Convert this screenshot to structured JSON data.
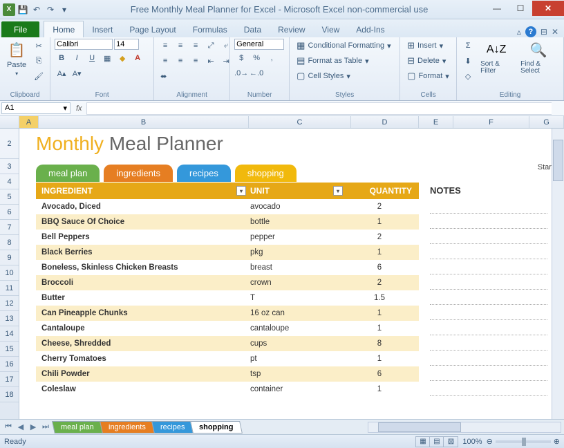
{
  "window": {
    "title": "Free Monthly Meal Planner for Excel  -  Microsoft Excel non-commercial use"
  },
  "qat": {
    "save": "💾",
    "undo": "↶",
    "redo": "↷",
    "more": "▾"
  },
  "tabs": {
    "file": "File",
    "items": [
      "Home",
      "Insert",
      "Page Layout",
      "Formulas",
      "Data",
      "Review",
      "View",
      "Add-Ins"
    ],
    "active": "Home"
  },
  "ribbon": {
    "clipboard": {
      "label": "Clipboard",
      "paste": "Paste"
    },
    "font": {
      "label": "Font",
      "name": "Calibri",
      "size": "14"
    },
    "alignment": {
      "label": "Alignment"
    },
    "number": {
      "label": "Number",
      "format": "General"
    },
    "styles": {
      "label": "Styles",
      "cond": "Conditional Formatting",
      "table": "Format as Table",
      "cell": "Cell Styles"
    },
    "cells": {
      "label": "Cells",
      "insert": "Insert",
      "delete": "Delete",
      "format": "Format"
    },
    "editing": {
      "label": "Editing",
      "sort": "Sort & Filter",
      "find": "Find & Select"
    }
  },
  "namebox": "A1",
  "cols": {
    "A": 28,
    "B": 304,
    "C": 148,
    "D": 98,
    "E": 50,
    "F": 110,
    "G": 60
  },
  "template": {
    "title1": "Monthly",
    "title2": " Meal Planner",
    "startd": "Start D",
    "tabs": [
      {
        "label": "meal plan",
        "cls": "g"
      },
      {
        "label": "ingredients",
        "cls": "o"
      },
      {
        "label": "recipes",
        "cls": "b"
      },
      {
        "label": "shopping",
        "cls": "y"
      }
    ],
    "headers": {
      "c1": "INGREDIENT",
      "c2": "UNIT",
      "c3": "QUANTITY"
    },
    "notes": "NOTES",
    "rows": [
      {
        "ing": "Avocado, Diced",
        "unit": "avocado",
        "qty": "2"
      },
      {
        "ing": "BBQ Sauce Of Choice",
        "unit": "bottle",
        "qty": "1"
      },
      {
        "ing": "Bell Peppers",
        "unit": "pepper",
        "qty": "2"
      },
      {
        "ing": "Black Berries",
        "unit": "pkg",
        "qty": "1"
      },
      {
        "ing": "Boneless, Skinless Chicken Breasts",
        "unit": "breast",
        "qty": "6"
      },
      {
        "ing": "Broccoli",
        "unit": "crown",
        "qty": "2"
      },
      {
        "ing": "Butter",
        "unit": "T",
        "qty": "1.5"
      },
      {
        "ing": "Can Pineapple Chunks",
        "unit": "16 oz can",
        "qty": "1"
      },
      {
        "ing": "Cantaloupe",
        "unit": "cantaloupe",
        "qty": "1"
      },
      {
        "ing": "Cheese, Shredded",
        "unit": "cups",
        "qty": "8"
      },
      {
        "ing": "Cherry Tomatoes",
        "unit": "pt",
        "qty": "1"
      },
      {
        "ing": "Chili Powder",
        "unit": "tsp",
        "qty": "6"
      },
      {
        "ing": "Coleslaw",
        "unit": "container",
        "qty": "1"
      }
    ]
  },
  "sheets": [
    {
      "label": "meal plan",
      "cls": "g"
    },
    {
      "label": "ingredients",
      "cls": "o"
    },
    {
      "label": "recipes",
      "cls": "b"
    },
    {
      "label": "shopping",
      "cls": "active"
    }
  ],
  "status": {
    "ready": "Ready",
    "zoom": "100%"
  }
}
